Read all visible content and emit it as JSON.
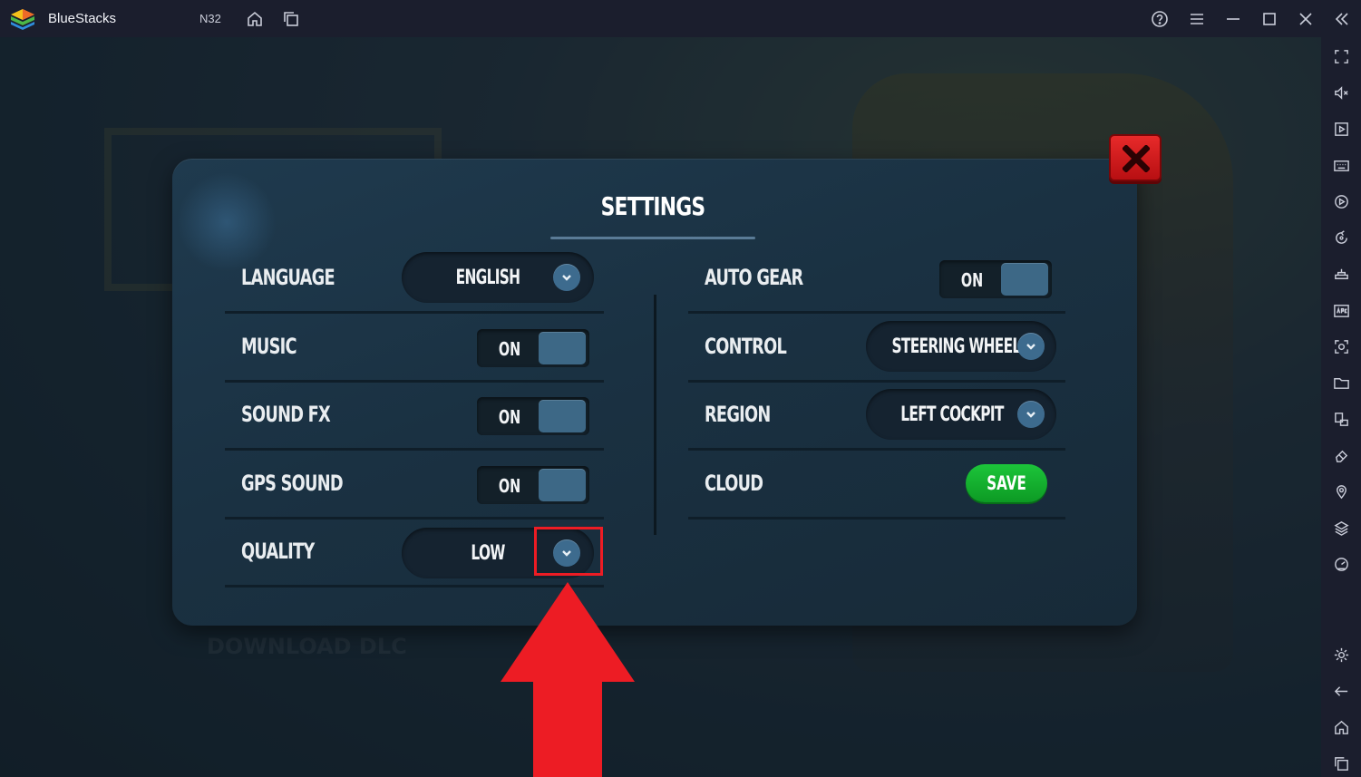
{
  "titlebar": {
    "app_name": "BlueStacks",
    "instance": "N32",
    "icons": [
      "home-icon",
      "multi-instance-icon",
      "help-icon",
      "menu-icon",
      "minimize-icon",
      "maximize-icon",
      "close-icon",
      "collapse-sidebar-icon"
    ]
  },
  "sidebar": {
    "icons": [
      "fullscreen-icon",
      "volume-mute-icon",
      "media-icon",
      "keyboard-icon",
      "macro-icon",
      "rotate-icon",
      "gamepad-icon",
      "apk-icon",
      "screenshot-icon",
      "folder-icon",
      "multi-window-icon",
      "eraser-icon",
      "location-icon",
      "layers-icon",
      "speed-icon",
      "settings-icon",
      "back-icon",
      "home-icon",
      "recent-apps-icon"
    ]
  },
  "background": {
    "dlc_text": "DOWNLOAD DLC"
  },
  "settings": {
    "title": "SETTINGS",
    "left": [
      {
        "label": "LANGUAGE",
        "type": "dropdown",
        "value": "ENGLISH"
      },
      {
        "label": "MUSIC",
        "type": "toggle",
        "value": "ON"
      },
      {
        "label": "SOUND FX",
        "type": "toggle",
        "value": "ON"
      },
      {
        "label": "GPS SOUND",
        "type": "toggle",
        "value": "ON"
      },
      {
        "label": "QUALITY",
        "type": "dropdown",
        "value": "LOW"
      }
    ],
    "right": [
      {
        "label": "AUTO GEAR",
        "type": "toggle",
        "value": "ON"
      },
      {
        "label": "CONTROL",
        "type": "dropdown",
        "value": "STEERING WHEEL"
      },
      {
        "label": "REGION",
        "type": "dropdown",
        "value": "LEFT COCKPIT"
      },
      {
        "label": "CLOUD",
        "type": "button",
        "value": "SAVE"
      }
    ]
  },
  "colors": {
    "close_button": "#d8161b",
    "save_button": "#14b02f",
    "annotation": "#ed1c24"
  }
}
